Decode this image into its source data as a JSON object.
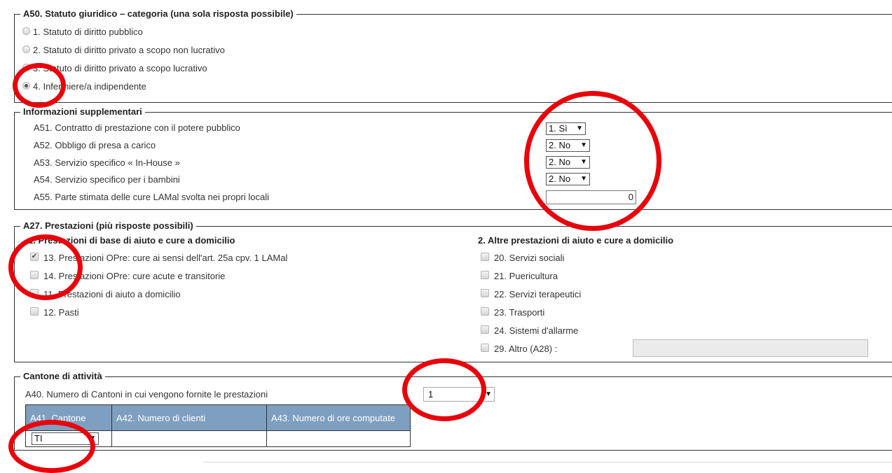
{
  "statuto": {
    "legend": "A50. Statuto giuridico – categoria (una sola risposta possibile)",
    "options": [
      "1. Statuto di diritto pubblico",
      "2. Statuto di diritto privato a scopo non lucrativo",
      "3. Statuto di diritto privato a scopo lucrativo",
      "4. Infermiere/a indipendente"
    ],
    "selected_index": 3
  },
  "supplementari": {
    "legend": "Informazioni supplementari",
    "rows": [
      {
        "label": "A51. Contratto di prestazione con il potere pubblico",
        "value": "1. Sì"
      },
      {
        "label": "A52. Obbligo di presa a carico",
        "value": "2. No"
      },
      {
        "label": "A53. Servizio specifico « In-House »",
        "value": "2. No"
      },
      {
        "label": "A54. Servizio specifico per i bambini",
        "value": "2. No"
      },
      {
        "label": "A55. Parte stimata delle cure LAMal svolta nei propri locali",
        "value": "0"
      }
    ],
    "dropdown_arrow": "▼"
  },
  "prestazioni": {
    "legend": "A27. Prestazioni (più risposte possibili)",
    "col1_title": "1. Prestazioni di base di aiuto e cure a domicilio",
    "col1_items": [
      {
        "label": "13. Prestazioni OPre: cure ai sensi dell'art. 25a cpv. 1 LAMal",
        "checked": true
      },
      {
        "label": "14. Prestazioni OPre: cure acute e transitorie",
        "checked": false
      },
      {
        "label": "11. Prestazioni di aiuto a domicilio",
        "checked": false
      },
      {
        "label": "12. Pasti",
        "checked": false
      }
    ],
    "col2_title": "2. Altre prestazioni di aiuto e cure a domicilio",
    "col2_items": [
      {
        "label": "20. Servizi sociali",
        "checked": false
      },
      {
        "label": "21. Puericultura",
        "checked": false
      },
      {
        "label": "22. Servizi terapeutici",
        "checked": false
      },
      {
        "label": "23. Trasporti",
        "checked": false
      },
      {
        "label": "24. Sistemi d'allarme",
        "checked": false
      },
      {
        "label": "29. Altro (A28) :",
        "checked": false
      }
    ],
    "check_mark": "✔"
  },
  "cantone": {
    "legend": "Cantone di attività",
    "a40_label": "A40. Numero di Cantoni in cui vengono fornite le prestazioni",
    "a40_value": "1",
    "table_headers": [
      "A41. Cantone",
      "A42. Numero di clienti",
      "A43. Numero di ore computate"
    ],
    "row_cantone": "TI",
    "row_clienti": "",
    "row_ore": ""
  },
  "colors": {
    "annotation_ring": "#e8000b",
    "table_header_bg": "#7f9fc0"
  }
}
